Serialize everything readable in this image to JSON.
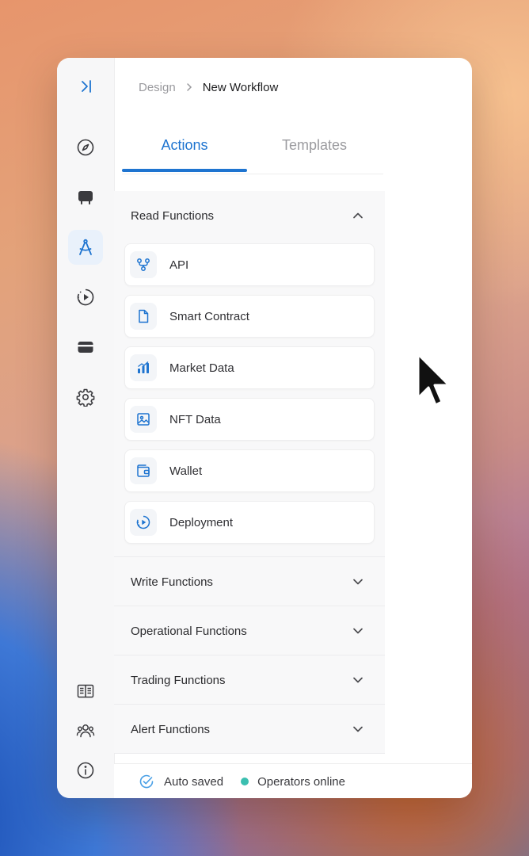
{
  "breadcrumb": {
    "parent": "Design",
    "current": "New Workflow"
  },
  "tabs": [
    {
      "label": "Actions",
      "active": true
    },
    {
      "label": "Templates",
      "active": false
    }
  ],
  "sections": {
    "read": {
      "title": "Read Functions",
      "expanded": true,
      "items": [
        {
          "label": "API",
          "icon": "api-icon"
        },
        {
          "label": "Smart Contract",
          "icon": "document-icon"
        },
        {
          "label": "Market Data",
          "icon": "bar-chart-icon"
        },
        {
          "label": "NFT Data",
          "icon": "image-icon"
        },
        {
          "label": "Wallet",
          "icon": "wallet-icon"
        },
        {
          "label": "Deployment",
          "icon": "play-circle-icon"
        }
      ]
    },
    "write": {
      "title": "Write Functions",
      "expanded": false
    },
    "operational": {
      "title": "Operational Functions",
      "expanded": false
    },
    "trading": {
      "title": "Trading Functions",
      "expanded": false
    },
    "alert": {
      "title": "Alert Functions",
      "expanded": false
    }
  },
  "footer": {
    "saved": "Auto saved",
    "online": "Operators online"
  },
  "colors": {
    "accent": "#1e74d0",
    "online": "#3bbfb0",
    "saved": "#4aa0e6"
  }
}
